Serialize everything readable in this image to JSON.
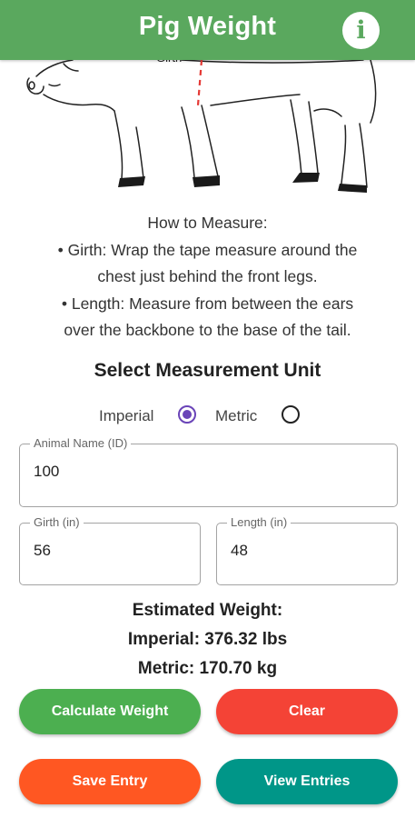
{
  "appbar": {
    "title": "Pig Weight",
    "info_icon": "info-icon"
  },
  "illustration": {
    "girth_label": "Girth"
  },
  "instructions": {
    "heading": "How to Measure:",
    "girth_line1": "• Girth: Wrap the tape measure around the",
    "girth_line2": "chest just behind the front legs.",
    "length_line1": "• Length: Measure from between the ears",
    "length_line2": "over the backbone to the base of the tail."
  },
  "unit_section": {
    "title": "Select Measurement Unit",
    "imperial_label": "Imperial",
    "metric_label": "Metric",
    "selected": "Imperial"
  },
  "form": {
    "animal_name": {
      "label": "Animal Name (ID)",
      "value": "100"
    },
    "girth": {
      "label": "Girth (in)",
      "value": "56"
    },
    "length": {
      "label": "Length (in)",
      "value": "48"
    }
  },
  "results": {
    "heading": "Estimated Weight:",
    "imperial": "Imperial: 376.32 lbs",
    "metric": "Metric: 170.70 kg"
  },
  "buttons": {
    "calculate": "Calculate Weight",
    "clear": "Clear",
    "save": "Save Entry",
    "view": "View Entries"
  },
  "colors": {
    "appbar": "#5aa85e",
    "calculate": "#4caf50",
    "clear": "#f44336",
    "save": "#ff5722",
    "view": "#009688",
    "radio_selected": "#6a44b8",
    "girth_line": "#e53935"
  }
}
